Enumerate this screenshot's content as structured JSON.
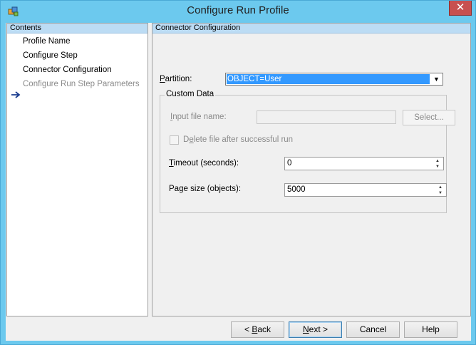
{
  "window": {
    "title": "Configure Run Profile",
    "close_glyph": "✕",
    "app_icon": "app-icon"
  },
  "left_pane": {
    "header": "Contents",
    "items": [
      {
        "label": "Profile Name"
      },
      {
        "label": "Configure Step"
      },
      {
        "label": "Connector Configuration",
        "current": true
      },
      {
        "label": "Configure Run Step Parameters",
        "disabled": true
      }
    ],
    "current_indicator_icon": "arrow-right-icon"
  },
  "right_pane": {
    "header": "Connector Configuration",
    "partition": {
      "label_access": "P",
      "label_rest": "artition:",
      "value": "OBJECT=User"
    },
    "custom_data": {
      "title": "Custom Data",
      "input_file": {
        "label_access": "I",
        "label_rest": "nput file name:",
        "value": "",
        "button": "Select..."
      },
      "delete_file": {
        "label_pre": "D",
        "label_access": "e",
        "label_rest": "lete file after successful run",
        "checked": false
      },
      "timeout": {
        "label_access": "T",
        "label_rest": "imeout (seconds):",
        "value": "0"
      },
      "page_size": {
        "label_pre": "Pa",
        "label_access": "g",
        "label_rest": "e size (objects):",
        "value": "5000"
      }
    }
  },
  "buttons": {
    "back": {
      "pre": "< ",
      "access": "B",
      "rest": "ack"
    },
    "next": {
      "access": "N",
      "rest": "ext >"
    },
    "cancel": "Cancel",
    "help": "Help"
  }
}
